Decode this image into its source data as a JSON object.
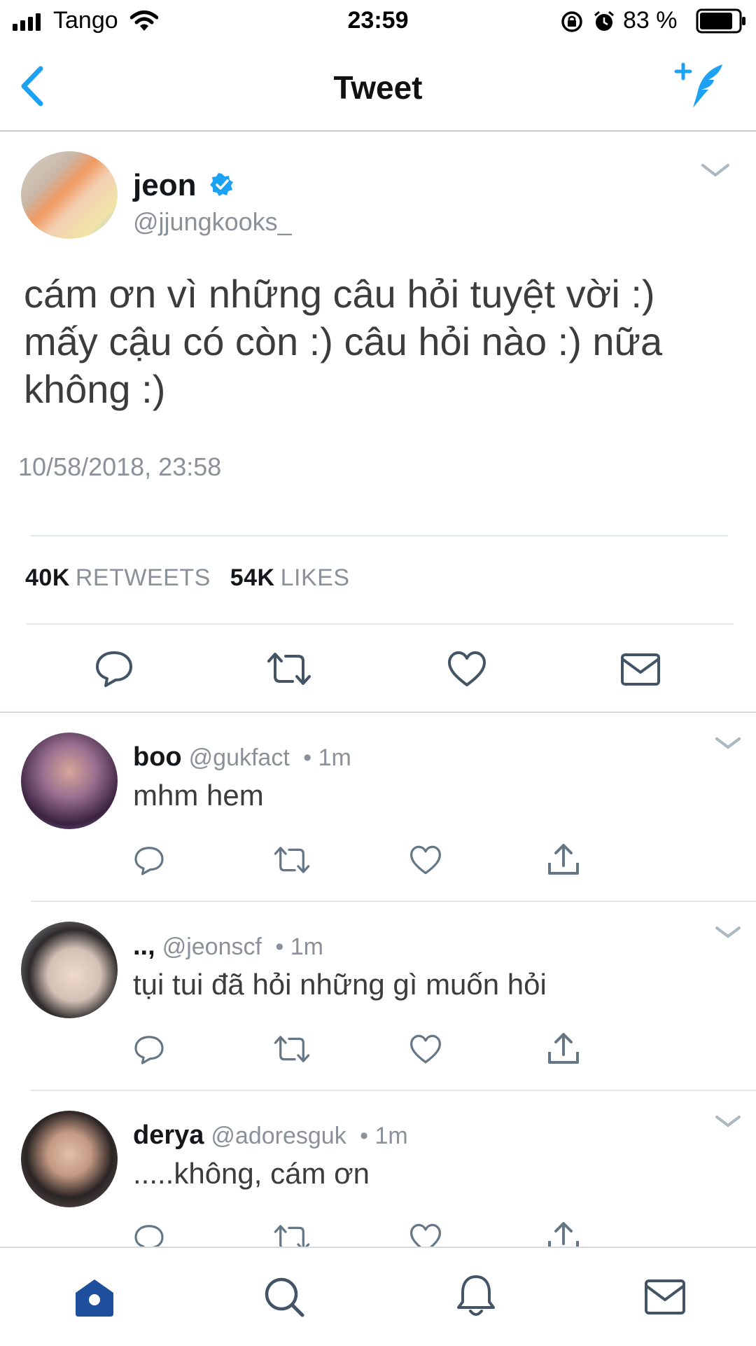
{
  "status_bar": {
    "carrier": "Tango",
    "time": "23:59",
    "battery": "83 %"
  },
  "nav": {
    "title": "Tweet"
  },
  "tweet": {
    "author_name": "jeon",
    "author_handle": "@jjungkooks_",
    "verified": true,
    "text": "cám ơn vì những câu hỏi tuyệt vời :) mấy cậu có còn :) câu hỏi nào :) nữa không :)",
    "timestamp": "10/58/2018, 23:58",
    "retweets_count": "40K",
    "retweets_label": "RETWEETS",
    "likes_count": "54K",
    "likes_label": "LIKES"
  },
  "replies": [
    {
      "name": "boo",
      "handle": "@gukfact",
      "time": "1m",
      "text": "mhm hem"
    },
    {
      "name": "..,",
      "handle": "@jeonscf",
      "time": "1m",
      "text": "tụi tui đã hỏi những gì muốn hỏi"
    },
    {
      "name": "derya",
      "handle": "@adoresguk",
      "time": "1m",
      "text": ".....không, cám ơn"
    }
  ],
  "colors": {
    "accent": "#1da1f2",
    "secondary_text": "#8a9199",
    "icon_gray": "#657786",
    "home_active": "#1d4f9c"
  },
  "icons": {
    "nav_back": "chevron-left-icon",
    "nav_compose": "compose-tweet-icon",
    "actions": [
      "reply-icon",
      "retweet-icon",
      "like-icon",
      "direct-message-icon"
    ],
    "reply_actions": [
      "reply-icon",
      "retweet-icon",
      "like-icon",
      "share-icon"
    ],
    "tabs": [
      "home-icon",
      "search-icon",
      "notifications-icon",
      "messages-icon"
    ]
  }
}
